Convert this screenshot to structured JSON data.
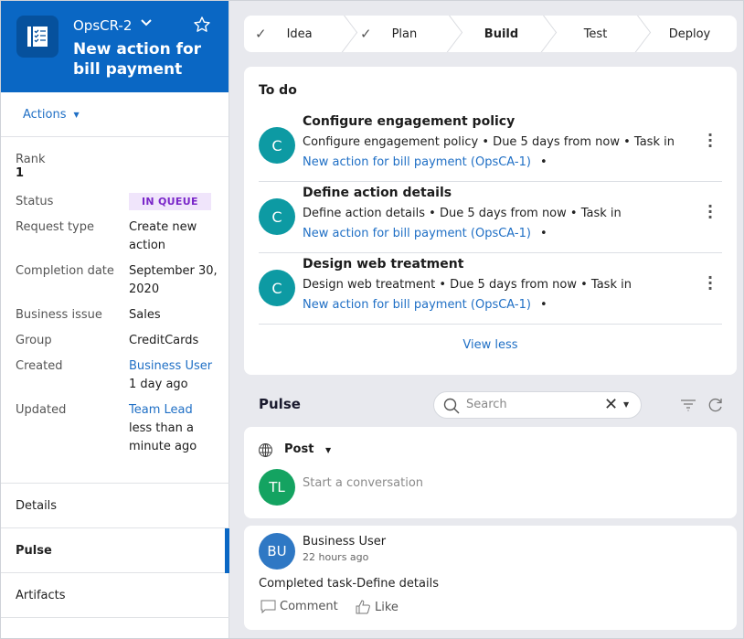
{
  "case": {
    "id": "OpsCR-2",
    "title": "New action for bill payment",
    "icon": "checklist-icon",
    "actions_label": "Actions"
  },
  "details": {
    "rank_label": "Rank",
    "rank_value": "1",
    "fields": [
      {
        "label": "Status",
        "value": "IN QUEUE",
        "type": "badge"
      },
      {
        "label": "Request type",
        "value": "Create new action"
      },
      {
        "label": "Completion date",
        "value": "September 30, 2020"
      },
      {
        "label": "Business issue",
        "value": "Sales"
      },
      {
        "label": "Group",
        "value": "CreditCards"
      },
      {
        "label": "Created",
        "link": "Business User",
        "value": "1 day ago"
      },
      {
        "label": "Updated",
        "link": "Team Lead",
        "value": "less than a minute ago"
      }
    ]
  },
  "nav": [
    {
      "label": "Details",
      "active": false
    },
    {
      "label": "Pulse",
      "active": true
    },
    {
      "label": "Artifacts",
      "active": false
    }
  ],
  "stages": [
    {
      "label": "Idea",
      "status": "done"
    },
    {
      "label": "Plan",
      "status": "done"
    },
    {
      "label": "Build",
      "status": "current"
    },
    {
      "label": "Test",
      "status": "future"
    },
    {
      "label": "Deploy",
      "status": "future"
    }
  ],
  "todo": {
    "title": "To do",
    "tasks": [
      {
        "avatar": "C",
        "title": "Configure engagement policy",
        "desc": "Configure engagement policy • Due 5 days from now • Task in",
        "link": "New action for bill payment (OpsCA-1)"
      },
      {
        "avatar": "C",
        "title": "Define action details",
        "desc": "Define action details • Due 5 days from now • Task in",
        "link": "New action for bill payment (OpsCA-1)"
      },
      {
        "avatar": "C",
        "title": "Design web treatment",
        "desc": "Design web treatment • Due 5 days from now • Task in",
        "link": "New action for bill payment (OpsCA-1)"
      }
    ],
    "view_less": "View less"
  },
  "pulse": {
    "title": "Pulse",
    "search_placeholder": "Search",
    "post_label": "Post",
    "composer_avatar": "TL",
    "composer_placeholder": "Start a conversation",
    "feed": [
      {
        "avatar": "BU",
        "author": "Business User",
        "time": "22 hours ago",
        "message": "Completed task-Define details",
        "comment_label": "Comment",
        "like_label": "Like"
      }
    ]
  },
  "colors": {
    "brand": "#0a67c4",
    "link": "#1f6fc5",
    "badge_bg": "#f0e5fb",
    "badge_text": "#7a26c9",
    "task_avatar": "#0d9aa3",
    "composer_avatar": "#14a361",
    "feed_avatar": "#2f78c4"
  }
}
